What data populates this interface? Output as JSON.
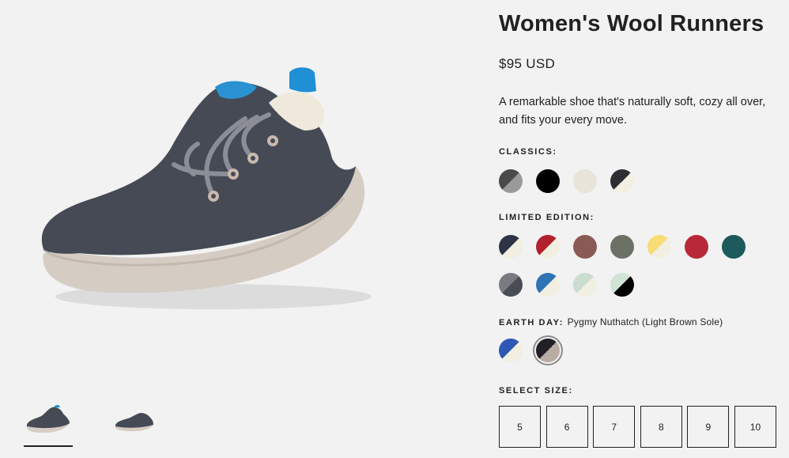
{
  "product": {
    "title": "Women's Wool Runners",
    "price": "$95 USD",
    "description": "A remarkable shoe that's naturally soft, cozy all over, and fits your every move."
  },
  "sections": {
    "classics_label": "CLASSICS:",
    "limited_label": "LIMITED EDITION:",
    "earth_label": "EARTH DAY:",
    "earth_selected": "Pygmy Nuthatch (Light Brown Sole)",
    "size_label": "SELECT SIZE:"
  },
  "swatches": {
    "classics": [
      {
        "a": "#4a4a4a",
        "b": "#9a9a9a"
      },
      {
        "a": "#000000",
        "b": "#000000"
      },
      {
        "a": "#e9e4d9",
        "b": "#e9e4d9"
      },
      {
        "a": "#2e2e33",
        "b": "#f1efe2"
      }
    ],
    "limited_row1": [
      {
        "a": "#2e3446",
        "b": "#f1efe2"
      },
      {
        "a": "#b3202d",
        "b": "#f1efe2"
      },
      {
        "a": "#8a5a55",
        "b": "#8a5a55"
      },
      {
        "a": "#6c7166",
        "b": "#6c7166"
      },
      {
        "a": "#f7dc76",
        "b": "#f1efe2"
      },
      {
        "a": "#b82836",
        "b": "#b82836"
      },
      {
        "a": "#1c5a5c",
        "b": "#1c5a5c"
      }
    ],
    "limited_row2": [
      {
        "a": "#7a7b80",
        "b": "#4a4c55"
      },
      {
        "a": "#2f73b5",
        "b": "#f1efe2"
      },
      {
        "a": "#c9ddd0",
        "b": "#f1efe2"
      },
      {
        "a": "#d0e3d5",
        "b": "#000000"
      }
    ],
    "earth": [
      {
        "a": "#2e58b4",
        "b": "#f1efe2",
        "selected": false
      },
      {
        "a": "#231f27",
        "b": "#b9aca3",
        "selected": true
      }
    ]
  },
  "sizes": [
    "5",
    "6",
    "7",
    "8",
    "9",
    "10"
  ]
}
